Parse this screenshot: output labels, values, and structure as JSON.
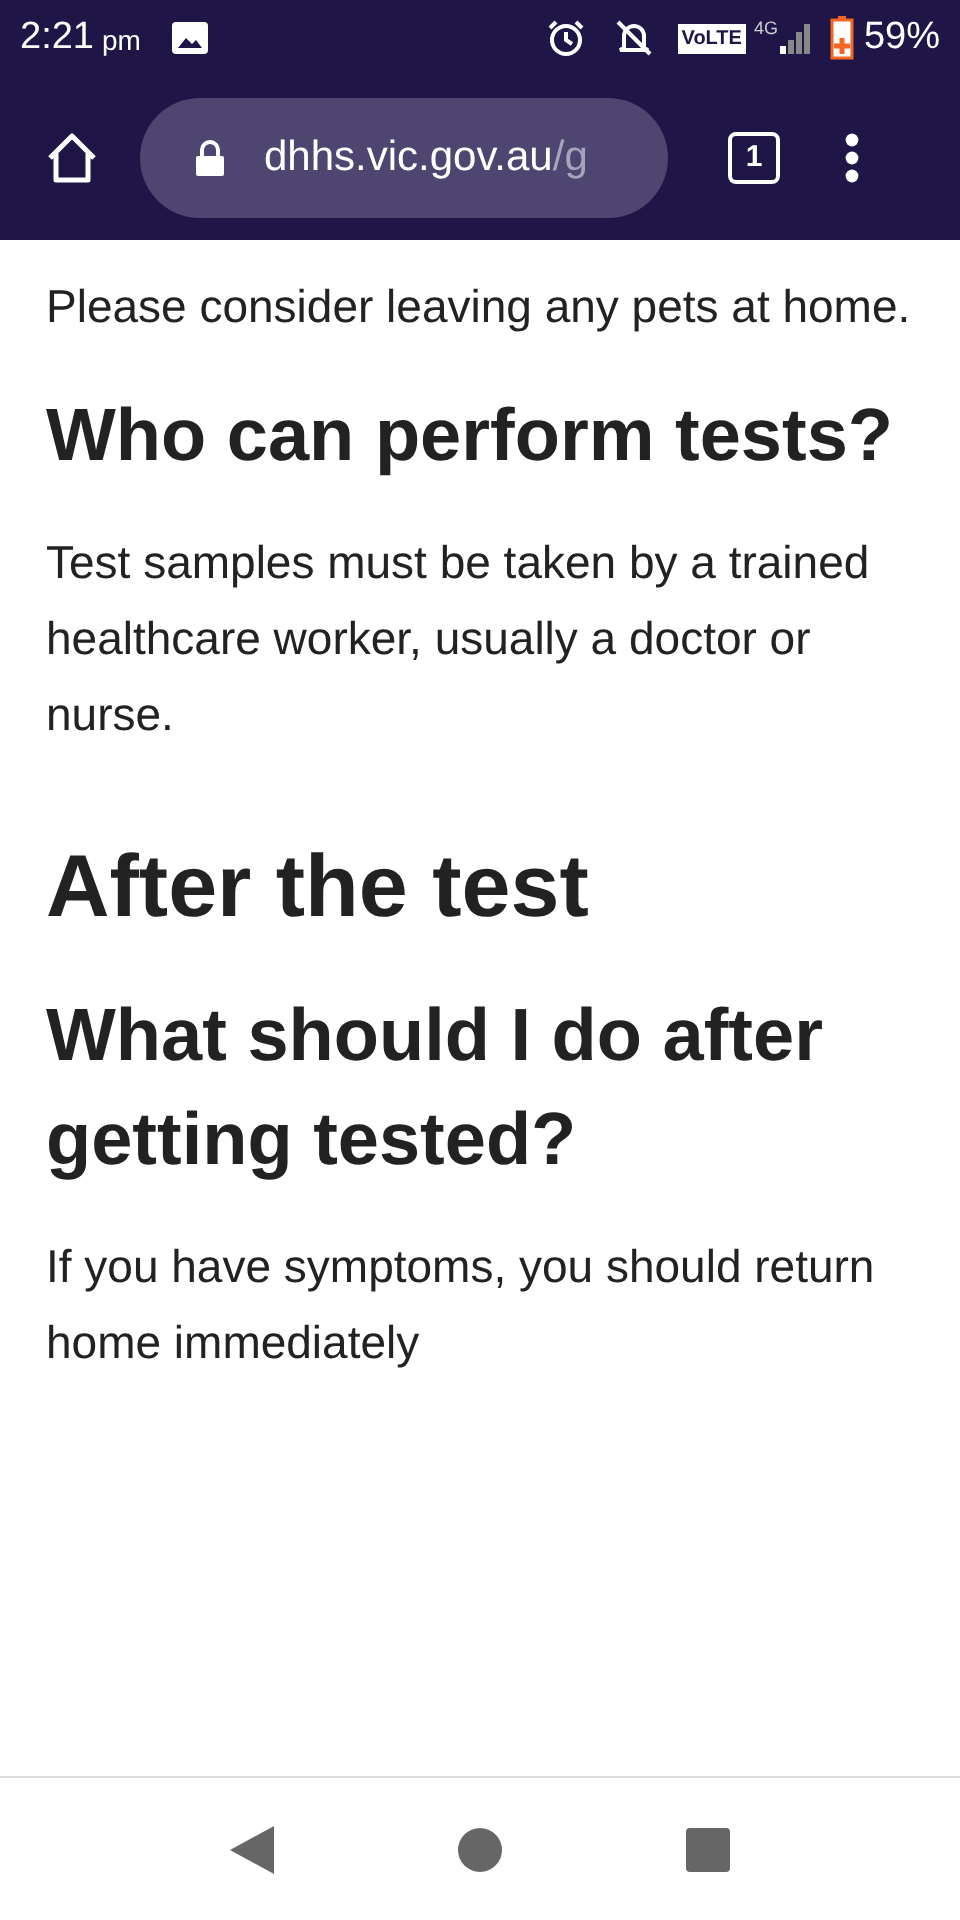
{
  "status_bar": {
    "time": "2:21",
    "ampm": "pm",
    "volte": "VoLTE",
    "network": "4G",
    "battery": "59%"
  },
  "toolbar": {
    "url_domain": "dhhs.vic.gov.au",
    "url_path": "/g",
    "tab_count": "1"
  },
  "content": [
    {
      "kind": "paragraph",
      "text": "Please consider leaving any pets at home."
    },
    {
      "kind": "subheading",
      "text": "Who can perform tests?"
    },
    {
      "kind": "paragraph",
      "text": "Test samples must be taken by a trained healthcare worker, usually a doctor or nurse."
    },
    {
      "kind": "heading",
      "text": "After the test"
    },
    {
      "kind": "subheading",
      "text": "What should I do after getting tested?"
    },
    {
      "kind": "paragraph",
      "text": "If you have symptoms, you should return home immediately"
    }
  ]
}
